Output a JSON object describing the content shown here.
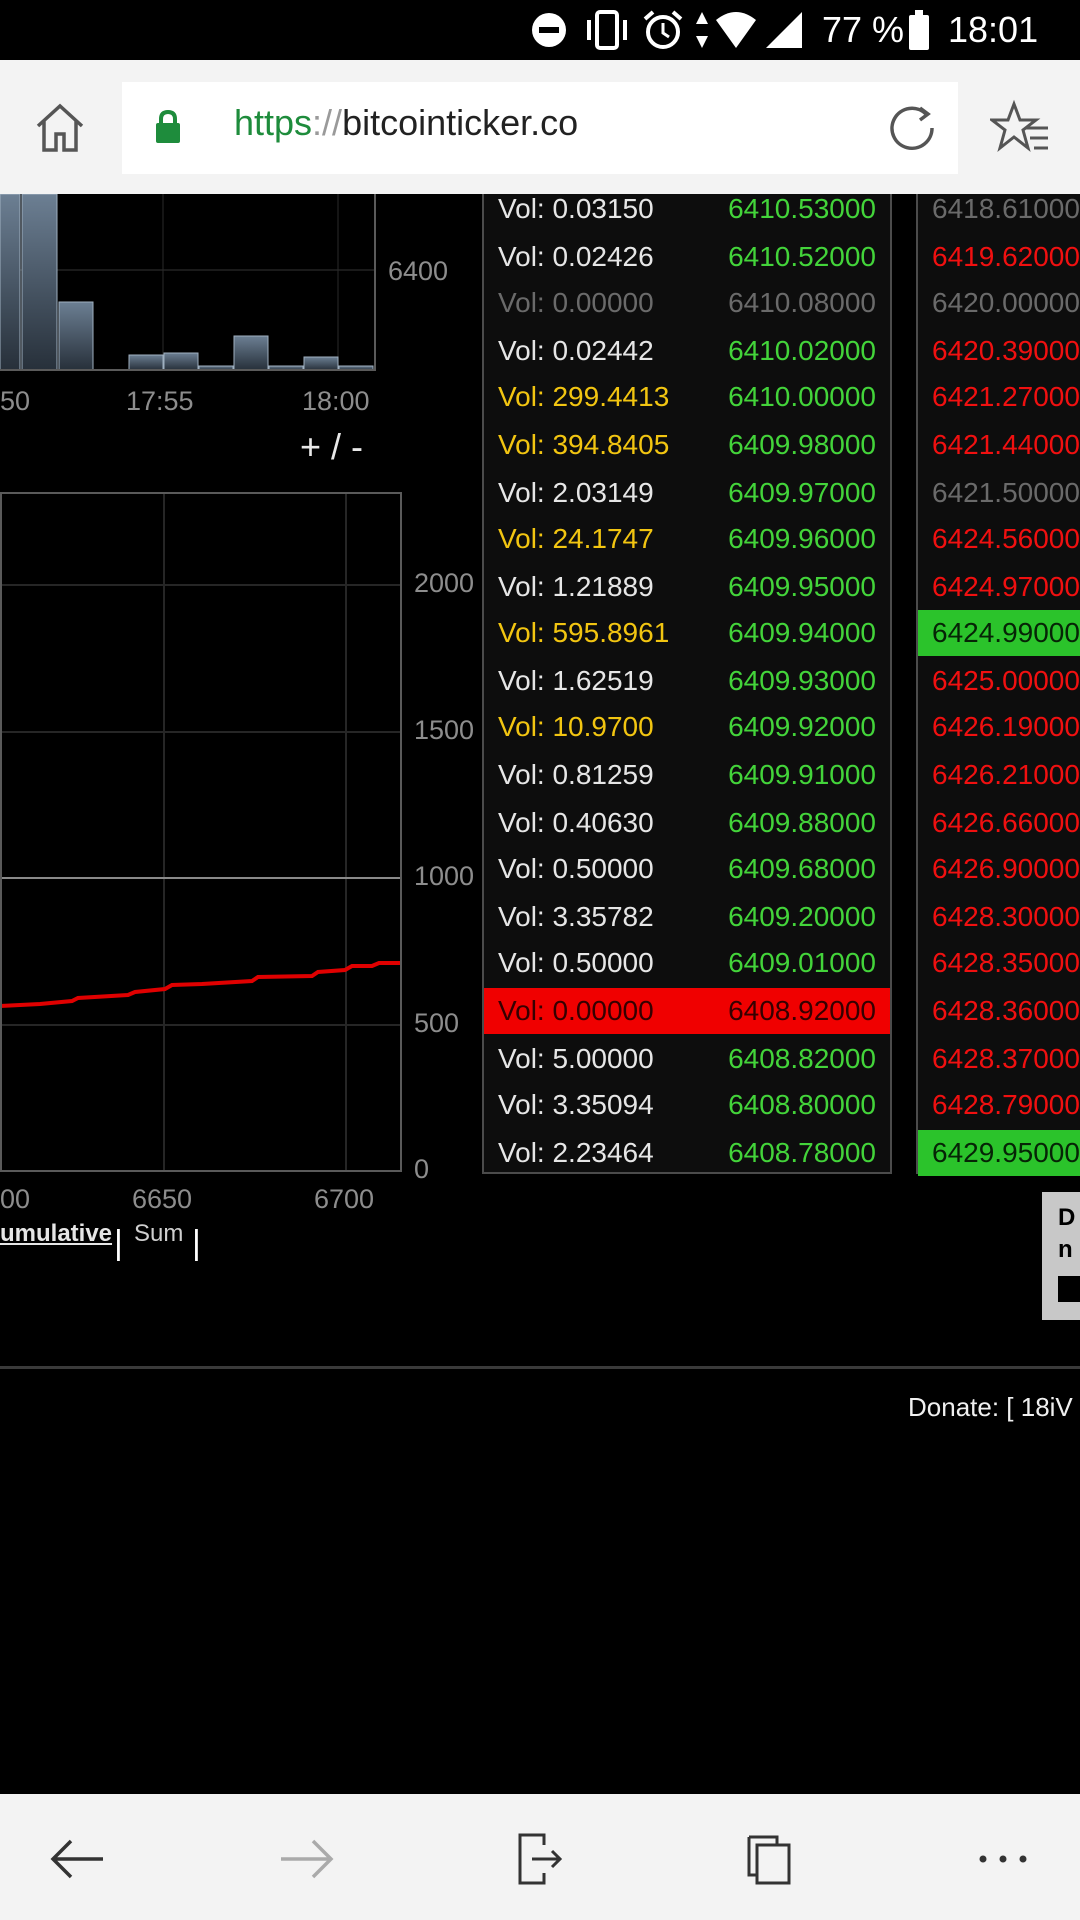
{
  "status_bar": {
    "battery": "77 %",
    "time": "18:01"
  },
  "browser": {
    "url_scheme": "https",
    "url_separator": "://",
    "url_host": "bitcointicker.co"
  },
  "price_chart": {
    "y_tick": "6400",
    "x_ticks": [
      "50",
      "17:55",
      "18:00"
    ],
    "zoom_label": "+ / -"
  },
  "depth_chart": {
    "y_ticks": [
      "2000",
      "1500",
      "1000",
      "500",
      "0"
    ],
    "x_ticks": [
      "00",
      "6650",
      "6700"
    ],
    "mode_cumulative": "umulative",
    "mode_separator": "|",
    "mode_sum": "Sum"
  },
  "bids": [
    {
      "vol": "Vol: 0.03150",
      "price": "6410.53000",
      "vcolor": "white",
      "pcolor": "green"
    },
    {
      "vol": "Vol: 0.02426",
      "price": "6410.52000",
      "vcolor": "white",
      "pcolor": "green"
    },
    {
      "vol": "Vol: 0.00000",
      "price": "6410.08000",
      "vcolor": "gray",
      "pcolor": "gray"
    },
    {
      "vol": "Vol: 0.02442",
      "price": "6410.02000",
      "vcolor": "white",
      "pcolor": "green"
    },
    {
      "vol": "Vol: 299.4413",
      "price": "6410.00000",
      "vcolor": "yellow",
      "pcolor": "green"
    },
    {
      "vol": "Vol: 394.8405",
      "price": "6409.98000",
      "vcolor": "yellow",
      "pcolor": "green"
    },
    {
      "vol": "Vol: 2.03149",
      "price": "6409.97000",
      "vcolor": "white",
      "pcolor": "green"
    },
    {
      "vol": "Vol: 24.1747",
      "price": "6409.96000",
      "vcolor": "yellow",
      "pcolor": "green"
    },
    {
      "vol": "Vol: 1.21889",
      "price": "6409.95000",
      "vcolor": "white",
      "pcolor": "green"
    },
    {
      "vol": "Vol: 595.8961",
      "price": "6409.94000",
      "vcolor": "yellow",
      "pcolor": "green"
    },
    {
      "vol": "Vol: 1.62519",
      "price": "6409.93000",
      "vcolor": "white",
      "pcolor": "green"
    },
    {
      "vol": "Vol: 10.9700",
      "price": "6409.92000",
      "vcolor": "yellow",
      "pcolor": "green"
    },
    {
      "vol": "Vol: 0.81259",
      "price": "6409.91000",
      "vcolor": "white",
      "pcolor": "green"
    },
    {
      "vol": "Vol: 0.40630",
      "price": "6409.88000",
      "vcolor": "white",
      "pcolor": "green"
    },
    {
      "vol": "Vol: 0.50000",
      "price": "6409.68000",
      "vcolor": "white",
      "pcolor": "green"
    },
    {
      "vol": "Vol: 3.35782",
      "price": "6409.20000",
      "vcolor": "white",
      "pcolor": "green"
    },
    {
      "vol": "Vol: 0.50000",
      "price": "6409.01000",
      "vcolor": "white",
      "pcolor": "green"
    },
    {
      "vol": "Vol: 0.00000",
      "price": "6408.92000",
      "vcolor": "red-hl",
      "pcolor": "red-hl"
    },
    {
      "vol": "Vol: 5.00000",
      "price": "6408.82000",
      "vcolor": "white",
      "pcolor": "green"
    },
    {
      "vol": "Vol: 3.35094",
      "price": "6408.80000",
      "vcolor": "white",
      "pcolor": "green"
    },
    {
      "vol": "Vol: 2.23464",
      "price": "6408.78000",
      "vcolor": "white",
      "pcolor": "green"
    }
  ],
  "asks": [
    {
      "price": "6418.61000",
      "color": "gray"
    },
    {
      "price": "6419.62000",
      "color": "red"
    },
    {
      "price": "6420.00000",
      "color": "gray"
    },
    {
      "price": "6420.39000",
      "color": "red"
    },
    {
      "price": "6421.27000",
      "color": "red"
    },
    {
      "price": "6421.44000",
      "color": "red"
    },
    {
      "price": "6421.50000",
      "color": "gray"
    },
    {
      "price": "6424.56000",
      "color": "red"
    },
    {
      "price": "6424.97000",
      "color": "red"
    },
    {
      "price": "6424.99000",
      "color": "green-hl"
    },
    {
      "price": "6425.00000",
      "color": "red"
    },
    {
      "price": "6426.19000",
      "color": "red"
    },
    {
      "price": "6426.21000",
      "color": "red"
    },
    {
      "price": "6426.66000",
      "color": "red"
    },
    {
      "price": "6426.90000",
      "color": "red"
    },
    {
      "price": "6428.30000",
      "color": "red"
    },
    {
      "price": "6428.35000",
      "color": "red"
    },
    {
      "price": "6428.36000",
      "color": "red"
    },
    {
      "price": "6428.37000",
      "color": "red"
    },
    {
      "price": "6428.79000",
      "color": "red"
    },
    {
      "price": "6429.95000",
      "color": "green-hl"
    }
  ],
  "partial_box": {
    "line1": "D",
    "line2": "n"
  },
  "footer": {
    "donate": "Donate: [ 18iV"
  },
  "colors": {
    "bid_green": "#43d43a",
    "ask_red": "#f01010",
    "volume_yellow": "#f2c511",
    "highlight_red": "#f00000",
    "highlight_green": "#2bc32b",
    "url_green": "#1e8c3c"
  },
  "icons": {
    "toolbar": [
      "home-icon",
      "lock-icon",
      "reload-icon",
      "favorites-icon"
    ],
    "bottom_nav": [
      "back-icon",
      "forward-icon",
      "share-icon",
      "tabs-icon",
      "more-icon"
    ]
  }
}
